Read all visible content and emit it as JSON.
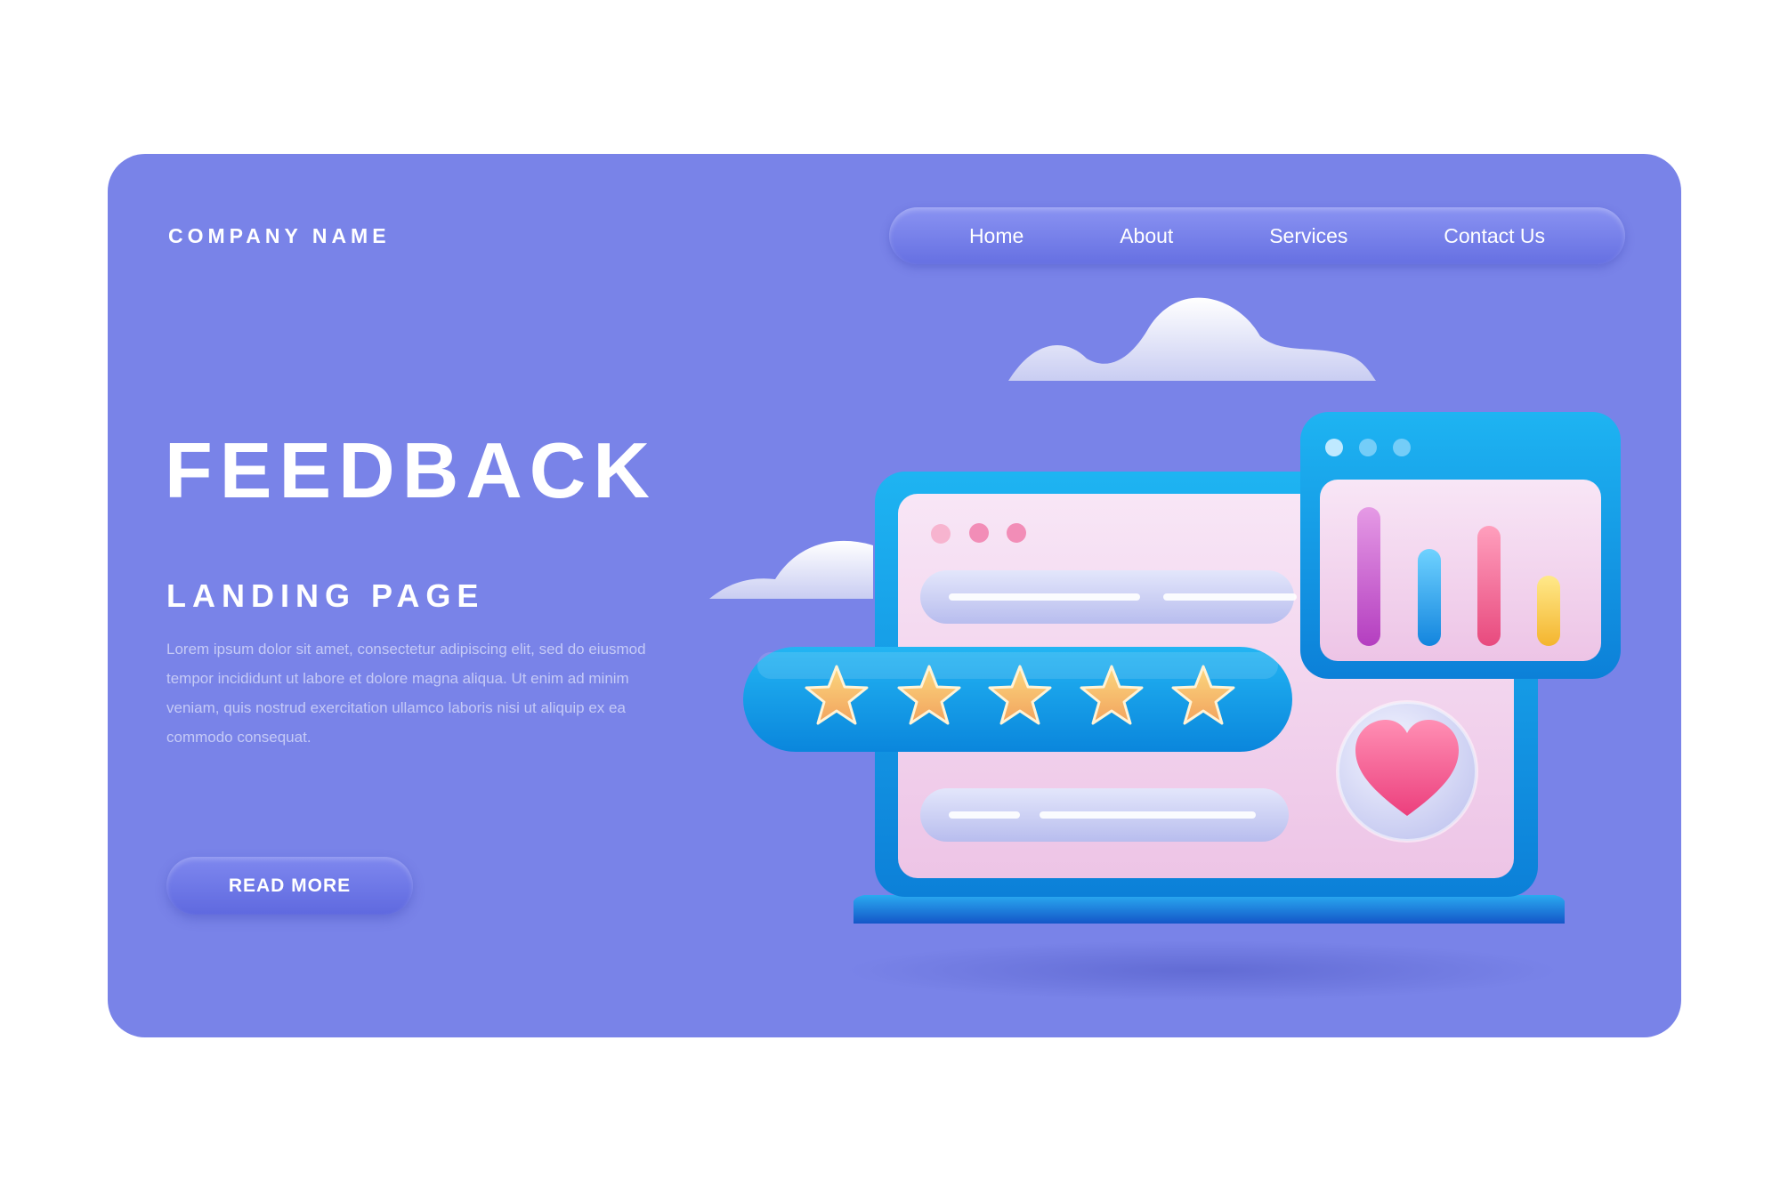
{
  "brand": {
    "company_name": "COMPANY NAME"
  },
  "nav": {
    "items": [
      {
        "label": "Home"
      },
      {
        "label": "About"
      },
      {
        "label": "Services"
      },
      {
        "label": "Contact Us"
      }
    ]
  },
  "hero": {
    "title": "FEEDBACK",
    "subtitle": "LANDING PAGE",
    "body": "Lorem ipsum dolor sit amet, consectetur adipiscing elit, sed do eiusmod tempor incididunt ut labore et dolore magna aliqua. Ut enim ad minim veniam, quis nostrud exercitation ullamco laboris nisi ut aliquip ex ea commodo consequat.",
    "cta_label": "READ MORE"
  },
  "illustration": {
    "rating": {
      "stars": 5,
      "max": 5
    },
    "icons": [
      "cloud-icon",
      "star-icon",
      "heart-icon",
      "bar-chart-icon"
    ],
    "colors": {
      "background": "#7983e8",
      "window_frame": "#16a3ea",
      "window_panel": "#f5d9ef",
      "star": "#f8c468",
      "heart": "#f2558f"
    }
  }
}
